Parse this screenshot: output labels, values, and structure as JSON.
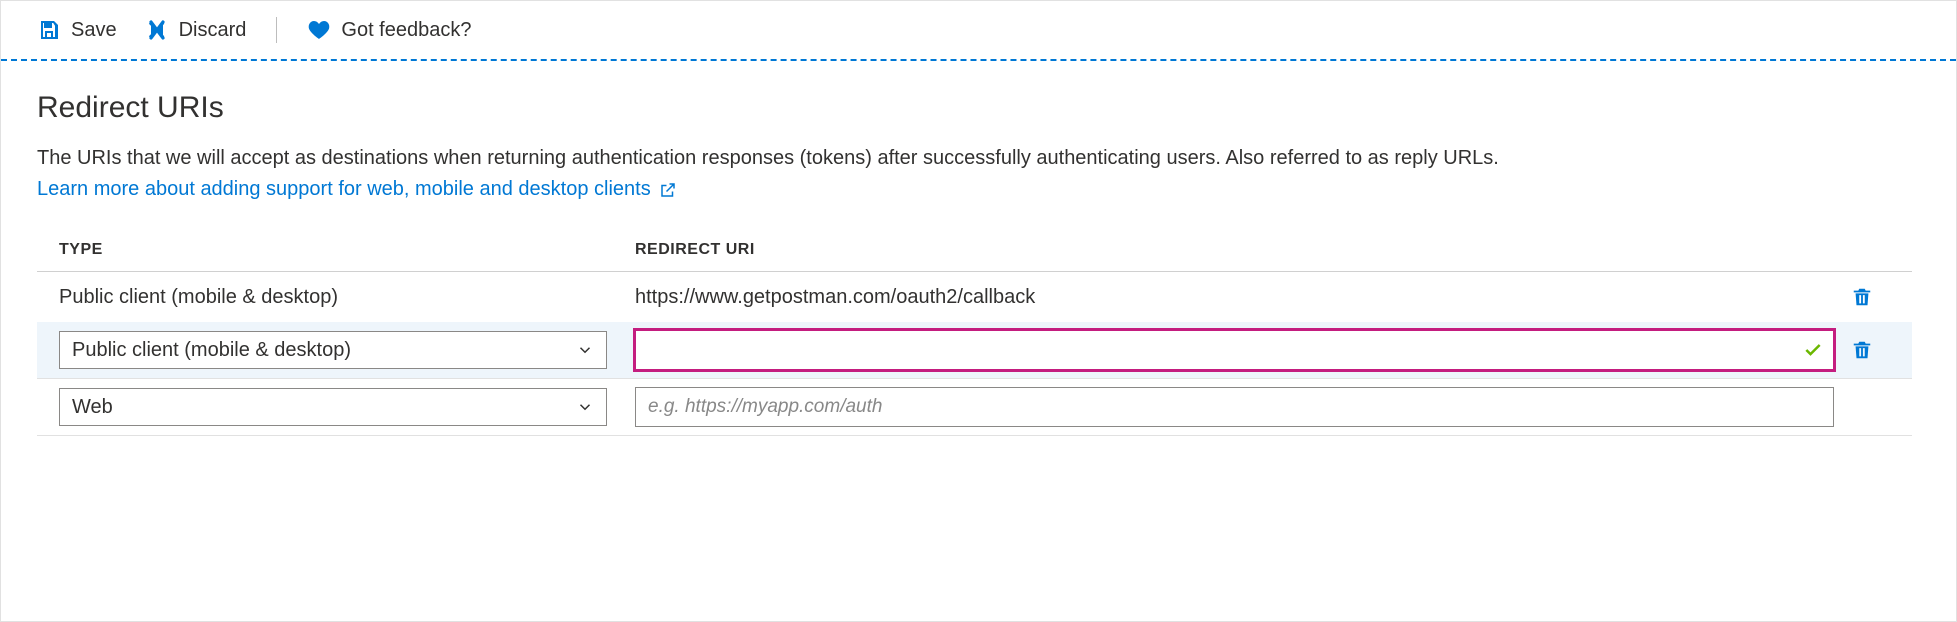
{
  "cmdbar": {
    "save": "Save",
    "discard": "Discard",
    "feedback": "Got feedback?"
  },
  "section": {
    "title": "Redirect URIs",
    "description": "The URIs that we will accept as destinations when returning authentication responses (tokens) after successfully authenticating users. Also referred to as reply URLs.",
    "learn_more": "Learn more about adding support for web, mobile and desktop clients"
  },
  "table": {
    "headers": {
      "type": "TYPE",
      "uri": "REDIRECT URI"
    },
    "rows": {
      "r0": {
        "type": "Public client (mobile & desktop)",
        "uri": "https://www.getpostman.com/oauth2/callback"
      },
      "r1": {
        "type": "Public client (mobile & desktop)",
        "uri": ""
      },
      "r2": {
        "type": "Web",
        "uri": "",
        "placeholder": "e.g. https://myapp.com/auth"
      }
    }
  }
}
